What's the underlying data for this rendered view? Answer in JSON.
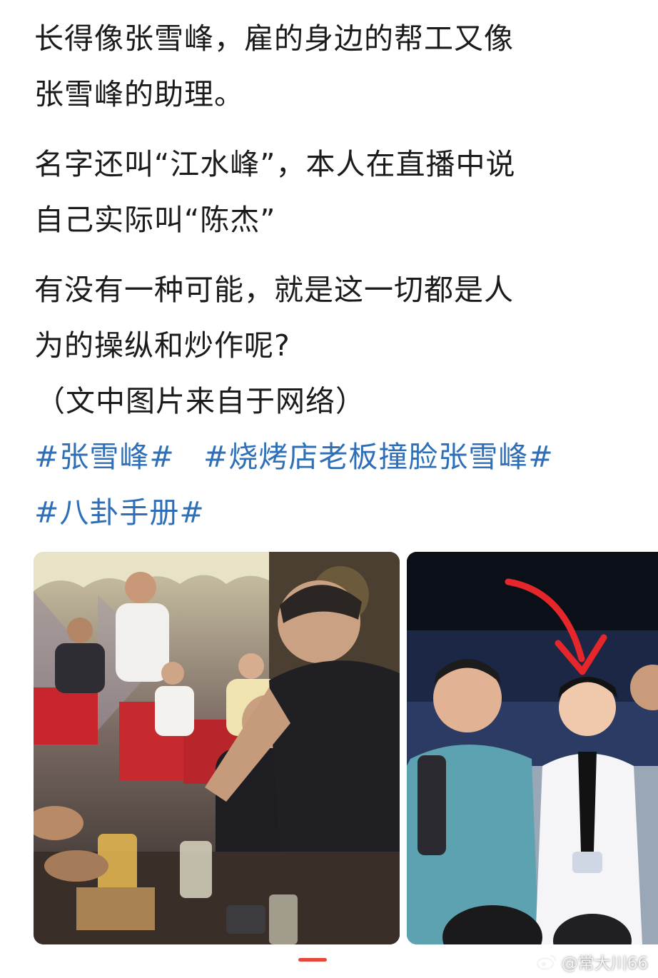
{
  "post": {
    "paragraphs": [
      "长得像张雪峰，雇的身边的帮工又像",
      "张雪峰的助理。",
      "名字还叫“江水峰”，本人在直播中说",
      "自己实际叫“陈杰”",
      "有没有一种可能，就是这一切都是人",
      "为的操纵和炒作呢?",
      "（文中图片来自于网络）"
    ],
    "hashtags": [
      "#张雪峰#",
      "#烧烤店老板撞脸张雪峰#",
      "#八卦手册#"
    ]
  },
  "images": [
    {
      "name": "bbq-restaurant-photo"
    },
    {
      "name": "stage-event-photo"
    }
  ],
  "carousel": {
    "active_index": 0
  },
  "watermark": {
    "text": "@常大川66",
    "icon": "weibo-icon"
  },
  "colors": {
    "text": "#1b1b1b",
    "hashtag": "#2e6fb7",
    "indicator": "#e5483a",
    "background": "#ffffff"
  }
}
